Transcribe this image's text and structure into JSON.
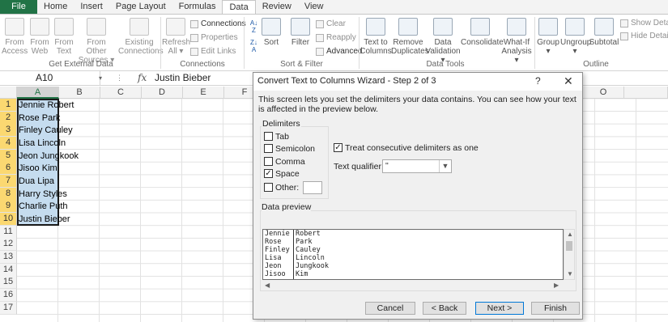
{
  "ribbon": {
    "tabs": [
      "File",
      "Home",
      "Insert",
      "Page Layout",
      "Formulas",
      "Data",
      "Review",
      "View"
    ],
    "active_tab": "Data",
    "groups": {
      "get_external": "Get External Data",
      "connections": "Connections",
      "sort_filter": "Sort & Filter",
      "data_tools": "Data Tools",
      "outline": "Outline"
    },
    "buttons": {
      "from_access": [
        "From",
        "Access"
      ],
      "from_web": [
        "From",
        "Web"
      ],
      "from_text": [
        "From",
        "Text"
      ],
      "from_other": [
        "From Other",
        "Sources ▾"
      ],
      "existing": [
        "Existing",
        "Connections"
      ],
      "refresh": [
        "Refresh",
        "All ▾"
      ],
      "sort": "Sort",
      "filter": "Filter",
      "text_to_columns": [
        "Text to",
        "Columns"
      ],
      "remove_dup": [
        "Remove",
        "Duplicates"
      ],
      "data_validation": [
        "Data",
        "Validation ▾"
      ],
      "consolidate": "Consolidate",
      "what_if": [
        "What-If",
        "Analysis ▾"
      ],
      "group": [
        "Group",
        "▾"
      ],
      "ungroup": [
        "Ungroup",
        "▾"
      ],
      "subtotal": "Subtotal"
    },
    "small": {
      "connections": "Connections",
      "properties": "Properties",
      "edit_links": "Edit Links",
      "clear": "Clear",
      "reapply": "Reapply",
      "advanced": "Advanced",
      "show_detail": "Show Detail",
      "hide_detail": "Hide Detail"
    }
  },
  "formula_bar": {
    "name_box": "A10",
    "fx": "fx",
    "value": "Justin Bieber"
  },
  "sheet": {
    "columns": [
      "A",
      "B",
      "C",
      "D",
      "E",
      "F",
      "O"
    ],
    "rows": [
      "1",
      "2",
      "3",
      "4",
      "5",
      "6",
      "7",
      "8",
      "9",
      "10",
      "11",
      "12",
      "13",
      "14",
      "15",
      "16",
      "17"
    ],
    "cells_a": [
      "Jennie Robert",
      "Rose Park",
      "Finley Cauley",
      "Lisa Lincoln",
      "Jeon Jungkook",
      "Jisoo Kim",
      "Dua Lipa",
      "Harry Styles",
      "Charlie Puth",
      "Justin Bieber"
    ]
  },
  "dialog": {
    "title": "Convert Text to Columns Wizard - Step 2 of 3",
    "help": "?",
    "close": "✕",
    "description": "This screen lets you set the delimiters your data contains.  You can see how your text is affected in the preview below.",
    "delimiters_label": "Delimiters",
    "options": {
      "tab": "Tab",
      "semicolon": "Semicolon",
      "comma": "Comma",
      "space": "Space",
      "other": "Other:"
    },
    "checked": {
      "tab": false,
      "semicolon": false,
      "comma": false,
      "space": true,
      "other": false,
      "consecutive": true
    },
    "consecutive": "Treat consecutive delimiters as one",
    "qualifier_label": "Text qualifier:",
    "qualifier_value": "\"",
    "preview_label": "Data preview",
    "preview_rows": [
      [
        "Jennie",
        "Robert"
      ],
      [
        "Rose",
        "Park"
      ],
      [
        "Finley",
        "Cauley"
      ],
      [
        "Lisa",
        "Lincoln"
      ],
      [
        "Jeon",
        "Jungkook"
      ],
      [
        "Jisoo",
        "Kim"
      ]
    ],
    "buttons": {
      "cancel": "Cancel",
      "back": "< Back",
      "next": "Next >",
      "finish": "Finish"
    }
  }
}
